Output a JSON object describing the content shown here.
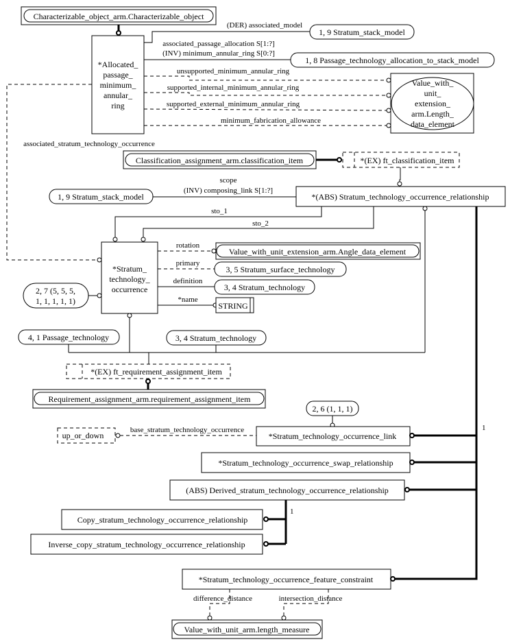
{
  "diagram": {
    "entities": {
      "characterizable_object": "Characterizable_object_arm.Characterizable_object",
      "allocated_ring": [
        "*Allocated_",
        "passage_",
        "minimum_",
        "annular_",
        "ring"
      ],
      "stratum_stack_model_top": "1, 9 Stratum_stack_model",
      "passage_alloc_model": "1, 8 Passage_technology_allocation_to_stack_model",
      "length_data_element": [
        "Value_with_",
        "unit_",
        "extension_",
        "arm.Length_",
        "data_element"
      ],
      "classification_item": "Classification_assignment_arm.classification_item",
      "ft_classification_item": "*(EX) ft_classification_item",
      "stratum_stack_model_mid": "1, 9 Stratum_stack_model",
      "sto_relationship": "*(ABS) Stratum_technology_occurrence_relationship",
      "stratum_tech_occ": [
        "*Stratum_",
        "technology_",
        "occurrence"
      ],
      "angle_data_element": "Value_with_unit_extension_arm.Angle_data_element",
      "surface_technology": "3, 5 Stratum_surface_technology",
      "stratum_technology_def": "3, 4 Stratum_technology",
      "string_type": "STRING",
      "page_ref_2_7": [
        "2, 7 (5, 5, 5,",
        "1, 1, 1, 1, 1)"
      ],
      "passage_technology": "4, 1 Passage_technology",
      "stratum_technology_low": "3, 4 Stratum_technology",
      "ft_requirement_item": "*(EX) ft_requirement_assignment_item",
      "requirement_item": "Requirement_assignment_arm.requirement_assignment_item",
      "page_ref_2_6": "2, 6 (1, 1, 1)",
      "up_or_down": "up_or_down",
      "sto_link": "*Stratum_technology_occurrence_link",
      "sto_swap": "*Stratum_technology_occurrence_swap_relationship",
      "derived_sto": "(ABS) Derived_stratum_technology_occurrence_relationship",
      "copy_sto": "Copy_stratum_technology_occurrence_relationship",
      "inverse_copy_sto": "Inverse_copy_stratum_technology_occurrence_relationship",
      "feature_constraint": "*Stratum_technology_occurrence_feature_constraint",
      "length_measure": "Value_with_unit_arm.length_measure"
    },
    "attributes": {
      "associated_model": "(DER) associated_model",
      "associated_passage_allocation": "associated_passage_allocation S[1:?]",
      "inv_minimum_annular_ring": "(INV) minimum_annular_ring S[0:?]",
      "unsupported": "unsupported_minimum_annular_ring",
      "supported_internal": "supported_internal_minimum_annular_ring",
      "supported_external": "supported_external_minimum_annular_ring",
      "min_fab_allowance": "minimum_fabrication_allowance",
      "associated_sto": "associated_stratum_technology_occurrence",
      "scope": "scope",
      "inv_composing_link": "(INV) composing_link S[1:?]",
      "sto_1": "sto_1",
      "sto_2": "sto_2",
      "rotation": "rotation",
      "primary": "primary",
      "definition": "definition",
      "name": "*name",
      "base_sto": "base_stratum_technology_occurrence",
      "difference_distance": "difference_distance",
      "intersection_distance": "intersection_distance"
    },
    "cardinality": {
      "one_of_main": "1",
      "one_of_derived": "1"
    }
  }
}
